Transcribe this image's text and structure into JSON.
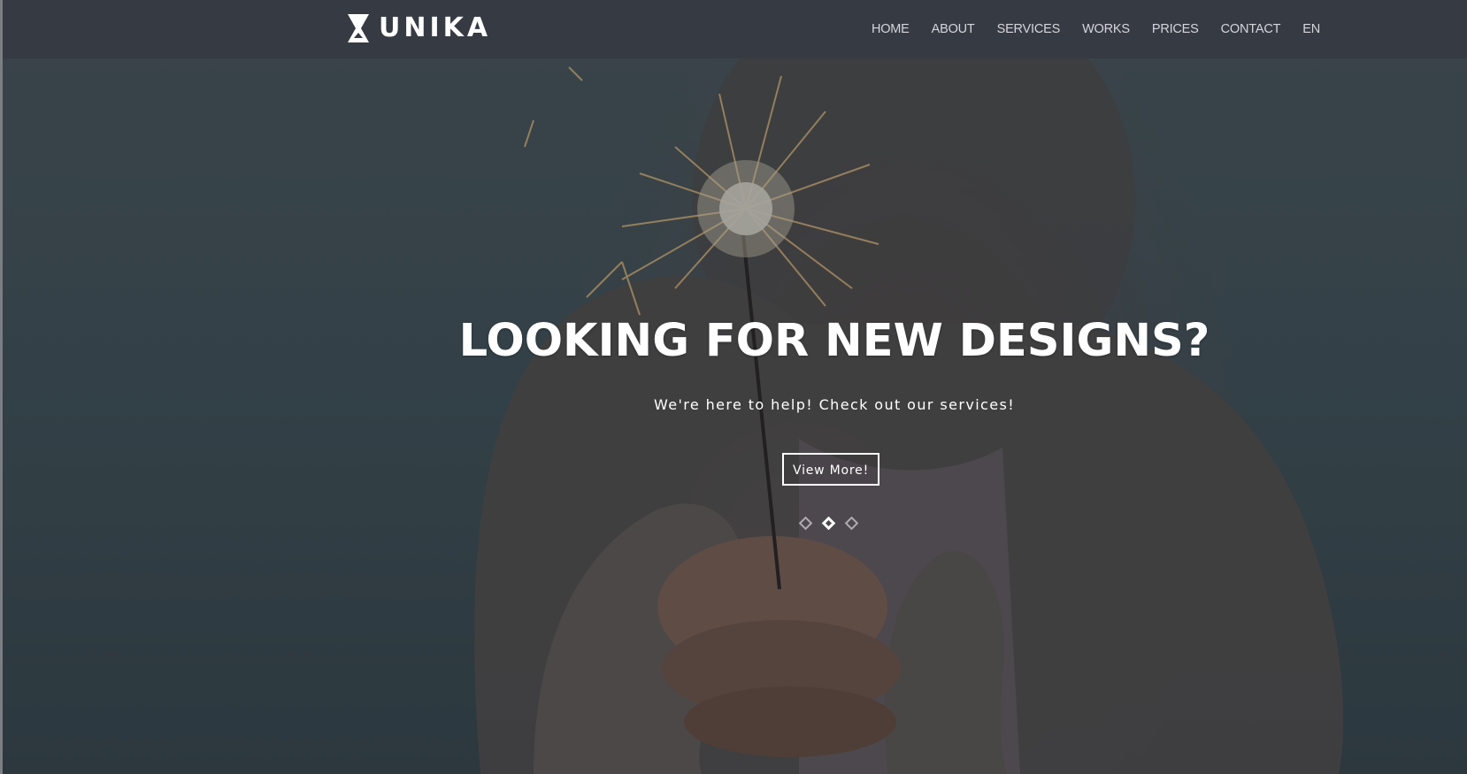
{
  "brand": {
    "name": "UNIKA",
    "logo_icon": "hourglass-logo-icon"
  },
  "nav": {
    "items": [
      {
        "label": "HOME"
      },
      {
        "label": "ABOUT"
      },
      {
        "label": "SERVICES"
      },
      {
        "label": "WORKS"
      },
      {
        "label": "PRICES"
      },
      {
        "label": "CONTACT"
      },
      {
        "label": "EN"
      }
    ]
  },
  "hero": {
    "title": "LOOKING FOR NEW DESIGNS?",
    "subtitle": "We're here to help! Check out our services!",
    "cta_label": "View More!",
    "slides_count": 3,
    "active_slide": 2
  },
  "colors": {
    "navbar": "#363a42",
    "text": "#ffffff",
    "nav_text": "#d4d6da"
  }
}
